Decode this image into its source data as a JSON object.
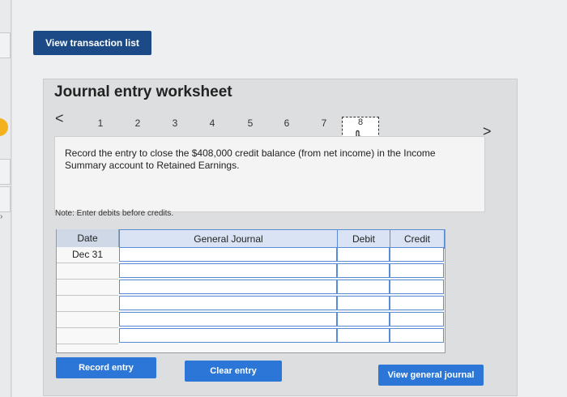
{
  "header": {
    "view_transaction_list": "View transaction list"
  },
  "worksheet": {
    "title": "Journal entry worksheet",
    "prev_arrow": "<",
    "next_arrow": ">",
    "tabs": [
      "1",
      "2",
      "3",
      "4",
      "5",
      "6",
      "7",
      "8"
    ],
    "active_tab": "8",
    "instruction": "Record the entry to close the $408,000 credit balance (from net income) in the Income Summary account to Retained Earnings.",
    "note": "Note: Enter debits before credits."
  },
  "table": {
    "headers": {
      "date": "Date",
      "general_journal": "General Journal",
      "debit": "Debit",
      "credit": "Credit"
    },
    "rows": [
      {
        "date": "Dec 31",
        "account": "",
        "debit": "",
        "credit": ""
      },
      {
        "date": "",
        "account": "",
        "debit": "",
        "credit": ""
      },
      {
        "date": "",
        "account": "",
        "debit": "",
        "credit": ""
      },
      {
        "date": "",
        "account": "",
        "debit": "",
        "credit": ""
      },
      {
        "date": "",
        "account": "",
        "debit": "",
        "credit": ""
      },
      {
        "date": "",
        "account": "",
        "debit": "",
        "credit": ""
      }
    ]
  },
  "buttons": {
    "record_entry": "Record entry",
    "clear_entry": "Clear entry",
    "view_general_journal": "View general journal"
  },
  "colors": {
    "dark_button": "#1c4a86",
    "primary_button": "#2b76d6",
    "input_border": "#5a8bd6",
    "side_badge": "#f3b21d"
  }
}
